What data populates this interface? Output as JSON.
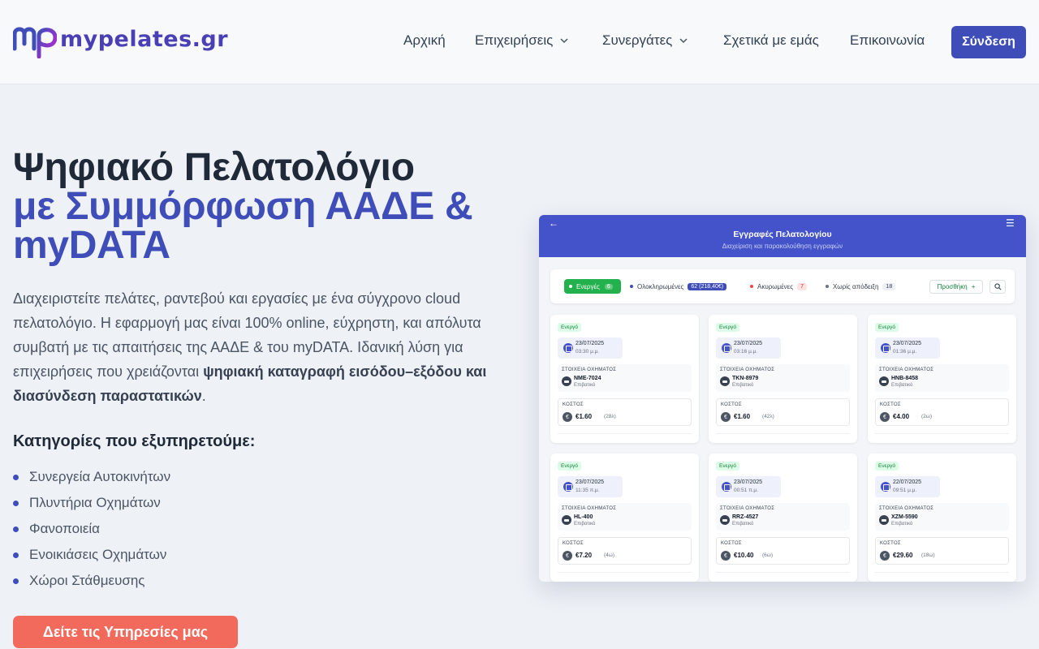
{
  "brand": {
    "logo_text": "mypelates.gr",
    "colors": {
      "primary": "#3f4db8",
      "accent_cta": "#f26a5c",
      "logo_pink": "#c026d3"
    }
  },
  "nav": {
    "items": [
      {
        "label": "Αρχική",
        "has_dropdown": false
      },
      {
        "label": "Επιχειρήσεις",
        "has_dropdown": true
      },
      {
        "label": "Συνεργάτες",
        "has_dropdown": true
      },
      {
        "label": "Σχετικά με εμάς",
        "has_dropdown": false
      },
      {
        "label": "Επικοινωνία",
        "has_dropdown": false
      }
    ],
    "login_label": "Σύνδεση"
  },
  "hero": {
    "title_line1": "Ψηφιακό Πελατολόγιο",
    "title_accent": "με Συμμόρφωση ΑΑΔΕ & myDATA",
    "description_plain": "Διαχειριστείτε πελάτες, ραντεβού και εργασίες με ένα σύγχρονο cloud πελατολόγιο. Η εφαρμογή μας είναι 100% online, εύχρηστη, και απόλυτα συμβατή με τις απαιτήσεις της ΑΑΔΕ & του myDATA. Ιδανική λύση για επιχειρήσεις που χρειάζονται ",
    "description_bold": "ψηφιακή καταγραφή εισόδου–εξόδου και διασύνδεση παραστατικών",
    "description_end": ".",
    "categories_title": "Κατηγορίες που εξυπηρετούμε:",
    "categories": [
      "Συνεργεία Αυτοκινήτων",
      "Πλυντήρια Οχημάτων",
      "Φανοποιεία",
      "Ενοικιάσεις Οχημάτων",
      "Χώροι Στάθμευσης"
    ],
    "cta_label": "Δείτε τις Υπηρεσίες μας"
  },
  "mockup": {
    "title": "Εγγραφές Πελατολογίου",
    "subtitle": "Διαχείριση και παρακολούθηση εγγραφών",
    "filters": {
      "active": {
        "label": "Ενεργές",
        "count": "6"
      },
      "completed": {
        "label": "Ολοκληρωμένες",
        "count": "62 (218,40€)"
      },
      "cancelled": {
        "label": "Ακυρωμένες",
        "count": "7"
      },
      "no_receipt": {
        "label": "Χωρίς απόδειξη",
        "count": "18"
      },
      "add_label": "Προσθήκη"
    },
    "vehicle_heading": "ΣΤΟΙΧΕΙΑ ΟΧΗΜΑΤΟΣ",
    "cost_heading": "ΚΟΣΤΟΣ",
    "records": [
      {
        "status": "Ενεργό",
        "date": "23/07/2025",
        "time": "03:30 μ.μ.",
        "plate": "NME-7024",
        "type": "Επιβατικό",
        "cost": "€1.60",
        "duration": "(28λ)"
      },
      {
        "status": "Ενεργό",
        "date": "23/07/2025",
        "time": "03:16 μ.μ.",
        "plate": "TKN-8979",
        "type": "Επιβατικό",
        "cost": "€1.60",
        "duration": "(42λ)"
      },
      {
        "status": "Ενεργό",
        "date": "23/07/2025",
        "time": "01:36 μ.μ.",
        "plate": "HNB-8458",
        "type": "Επιβατικό",
        "cost": "€4.00",
        "duration": "(2ω)"
      },
      {
        "status": "Ενεργό",
        "date": "23/07/2025",
        "time": "11:35 π.μ.",
        "plate": "HL-400",
        "type": "Επιβατικό",
        "cost": "€7.20",
        "duration": "(4ω)"
      },
      {
        "status": "Ενεργό",
        "date": "23/07/2025",
        "time": "00:51 π.μ.",
        "plate": "RRZ-4527",
        "type": "Επιβατικό",
        "cost": "€10.40",
        "duration": "(6ω)"
      },
      {
        "status": "Ενεργό",
        "date": "22/07/2025",
        "time": "09:51 μ.μ.",
        "plate": "XZM-5590",
        "type": "Επιβατικό",
        "cost": "€29.60",
        "duration": "(18ω)"
      }
    ]
  }
}
